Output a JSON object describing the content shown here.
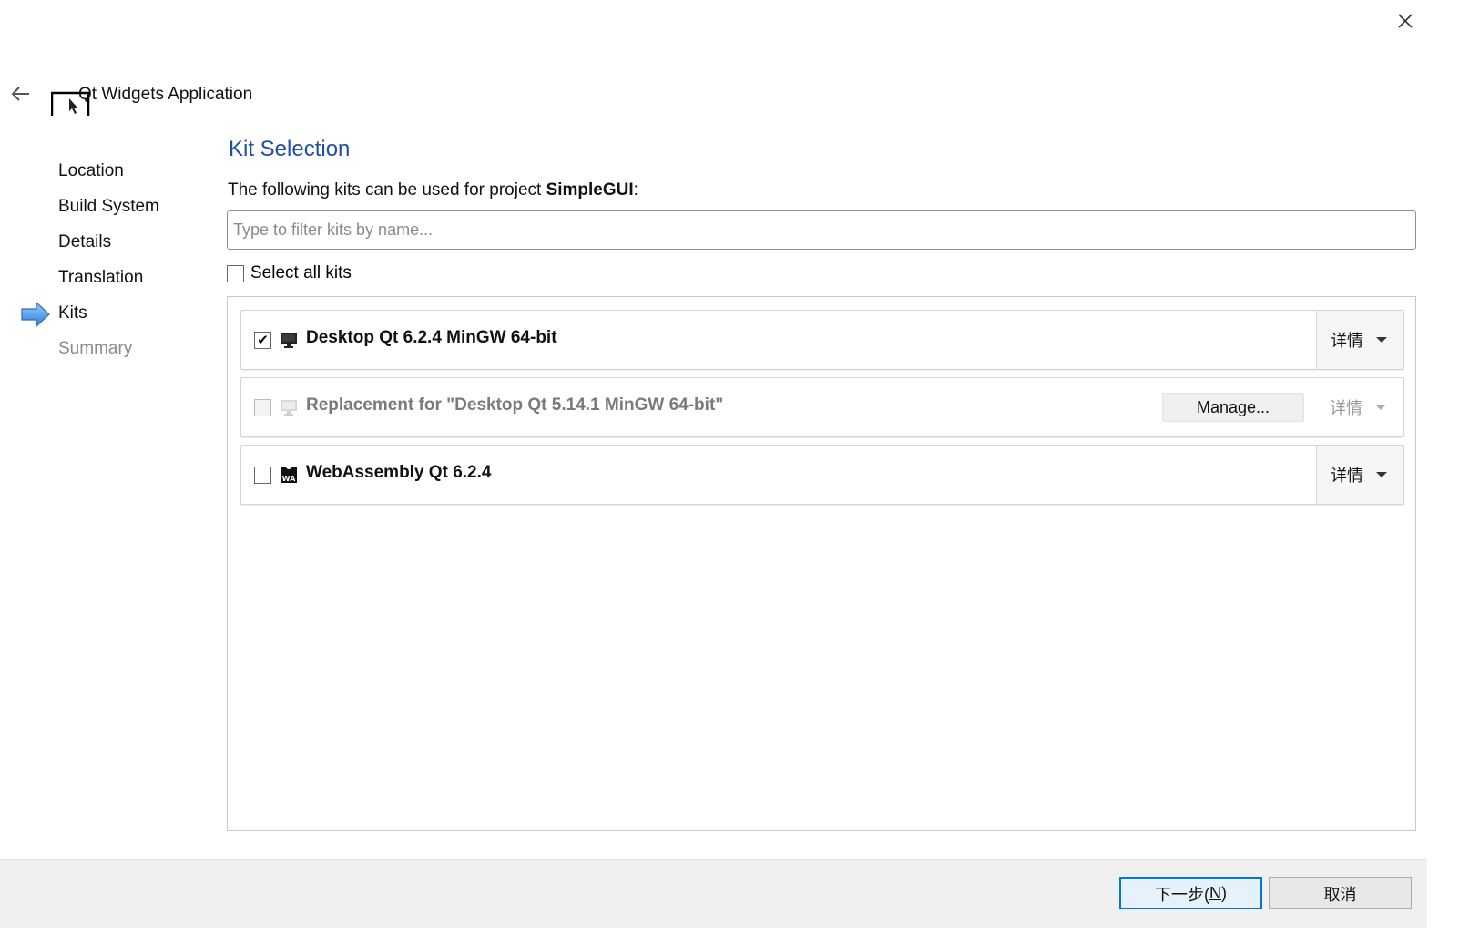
{
  "window": {
    "title": "Qt Widgets Application",
    "close_icon": "close-icon",
    "back_icon": "back-arrow-icon"
  },
  "steps": [
    {
      "label": "Location",
      "state": "done"
    },
    {
      "label": "Build System",
      "state": "done"
    },
    {
      "label": "Details",
      "state": "done"
    },
    {
      "label": "Translation",
      "state": "done"
    },
    {
      "label": "Kits",
      "state": "current"
    },
    {
      "label": "Summary",
      "state": "pending"
    }
  ],
  "page": {
    "title": "Kit Selection",
    "intro_prefix": "The following kits can be used for project ",
    "project_name": "SimpleGUI",
    "intro_suffix": ":"
  },
  "filter": {
    "value": "",
    "placeholder": "Type to filter kits by name..."
  },
  "select_all": {
    "label": "Select all kits",
    "checked": false
  },
  "kits": [
    {
      "name": "Desktop Qt 6.2.4 MinGW 64-bit",
      "checked": true,
      "enabled": true,
      "icon": "monitor-icon",
      "details_label": "详情"
    },
    {
      "name": "Replacement for \"Desktop Qt 5.14.1 MinGW 64-bit\"",
      "checked": false,
      "enabled": false,
      "icon": "monitor-icon",
      "manage_label": "Manage...",
      "details_label": "详情"
    },
    {
      "name": "WebAssembly Qt 6.2.4",
      "checked": false,
      "enabled": true,
      "icon": "webassembly-icon",
      "details_label": "详情"
    }
  ],
  "footer": {
    "next_label": "下一步(",
    "next_mnemonic": "N",
    "next_suffix": ")",
    "cancel_label": "取消"
  },
  "colors": {
    "accent_title": "#1e4fa1",
    "primary_button_border": "#0078d7",
    "step_arrow": "#3d8ee6"
  }
}
